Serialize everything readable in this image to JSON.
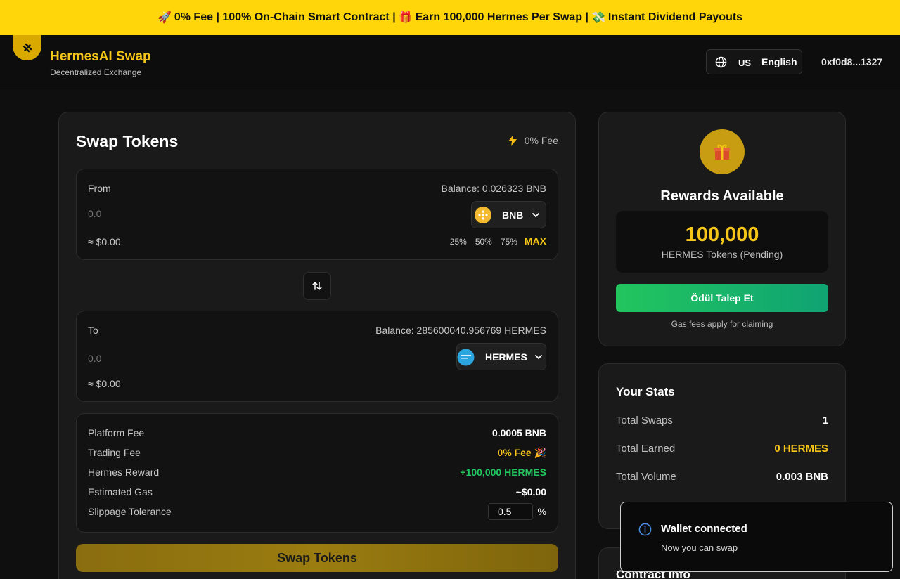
{
  "banner": {
    "items": [
      {
        "icon": "rocket-icon",
        "emoji": "🚀",
        "text": "0% Fee | 100% On-Chain Smart Contract |"
      },
      {
        "icon": "gift-icon",
        "emoji": "🎁",
        "text": "Earn 100,000 Hermes Per Swap |"
      },
      {
        "icon": "money-icon",
        "emoji": "💸",
        "text": "Instant Dividend Payouts"
      }
    ]
  },
  "header": {
    "brand": "HermesAI Swap",
    "subtitle": "Decentralized Exchange",
    "language_code": "US",
    "language": "English",
    "wallet": "0xf0d8...1327"
  },
  "swap": {
    "title": "Swap Tokens",
    "fee_tag": "0% Fee",
    "from": {
      "label": "From",
      "balance": "Balance: 0.026323 BNB",
      "amount_placeholder": "0.0",
      "usd": "≈ $0.00",
      "token": "BNB",
      "percents": [
        "25%",
        "50%",
        "75%"
      ],
      "max": "MAX"
    },
    "to": {
      "label": "To",
      "balance": "Balance: 285600040.956769 HERMES",
      "amount_placeholder": "0.0",
      "usd": "≈ $0.00",
      "token": "HERMES"
    },
    "details": {
      "platform_fee_label": "Platform Fee",
      "platform_fee_value": "0.0005 BNB",
      "trading_fee_label": "Trading Fee",
      "trading_fee_value": "0% Fee 🎉",
      "reward_label": "Hermes Reward",
      "reward_value": "+100,000 HERMES",
      "gas_label": "Estimated Gas",
      "gas_value": "~$0.00",
      "slippage_label": "Slippage Tolerance",
      "slippage_value": "0.5",
      "slippage_unit": "%"
    },
    "button": "Swap Tokens"
  },
  "rewards": {
    "title": "Rewards Available",
    "amount": "100,000",
    "unit": "HERMES Tokens (Pending)",
    "claim_button": "Ödül Talep Et",
    "note": "Gas fees apply for claiming"
  },
  "stats": {
    "title": "Your Stats",
    "rows": [
      {
        "label": "Total Swaps",
        "value": "1"
      },
      {
        "label": "Total Earned",
        "value": "0 HERMES"
      },
      {
        "label": "Total Volume",
        "value": "0.003 BNB"
      }
    ]
  },
  "contract": {
    "title": "Contract Info"
  },
  "toast": {
    "title": "Wallet connected",
    "message": "Now you can swap"
  },
  "colors": {
    "accent": "#f5c518",
    "banner": "#fed60a",
    "success": "#22c55e",
    "background": "#0f0f0f"
  }
}
